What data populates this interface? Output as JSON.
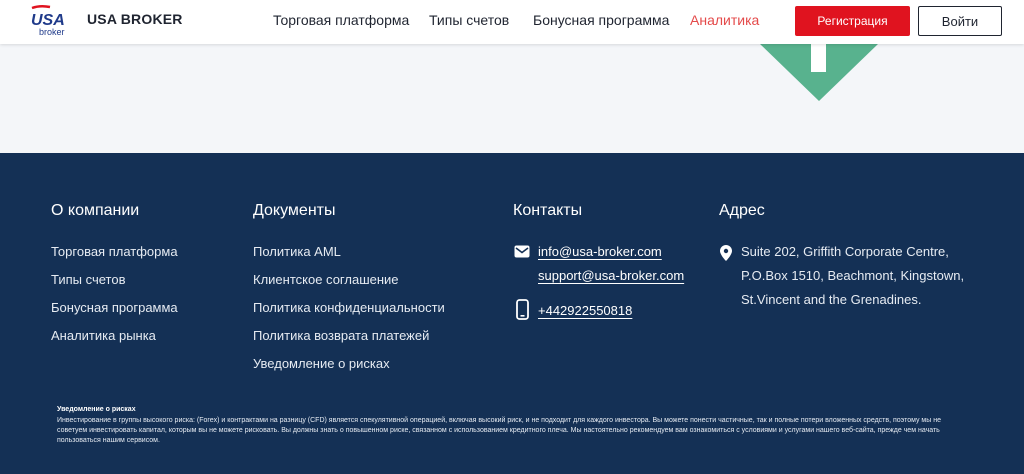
{
  "header": {
    "logo": {
      "mark": "USA",
      "sub": "broker"
    },
    "brand": "USA BROKER",
    "nav": [
      "Торговая платформа",
      "Типы счетов",
      "Бонусная программа",
      "Аналитика"
    ],
    "register_label": "Регистрация",
    "login_label": "Войти",
    "colors": {
      "accent_red": "#e0131f",
      "active_nav": "#e44a4a",
      "hero_arrow": "#58b28e"
    }
  },
  "footer": {
    "colors": {
      "background": "#143055"
    },
    "company": {
      "title": "О компании",
      "links": [
        "Торговая платформа",
        "Типы счетов",
        "Бонусная программа",
        "Аналитика рынка"
      ]
    },
    "documents": {
      "title": "Документы",
      "links": [
        "Политика AML",
        "Клиентское соглашение",
        "Политика конфиденциальности",
        "Политика возврата платежей",
        "Уведомление о рисках"
      ]
    },
    "contacts": {
      "title": "Контакты",
      "emails": [
        "info@usa-broker.com",
        "support@usa-broker.com"
      ],
      "phone": "+442922550818",
      "icons": [
        "envelope-icon",
        "phone-icon"
      ]
    },
    "address": {
      "title": "Адрес",
      "lines": [
        "Suite 202, Griffith Corporate Centre,",
        "P.O.Box 1510, Beachmont, Kingstown,",
        "St.Vincent and the Grenadines."
      ],
      "icon": "map-pin-icon"
    },
    "risk": {
      "title": "Уведомление о рисках",
      "text": "Инвестирование в группы высокого риска: (Forex) и контрактами на разницу (CFD) является спекулятивной операцией, включая высокий риск, и не подходит для каждого инвестора. Вы можете понести частичные, так и полные потери вложенных средств, поэтому мы не советуем инвестировать капитал, которым вы не можете рисковать. Вы должны знать о повышенном риске, связанном с использованием кредитного плеча. Мы настоятельно рекомендуем вам ознакомиться с условиями и услугами нашего веб-сайта, прежде чем начать пользоваться нашим сервисом."
    }
  }
}
